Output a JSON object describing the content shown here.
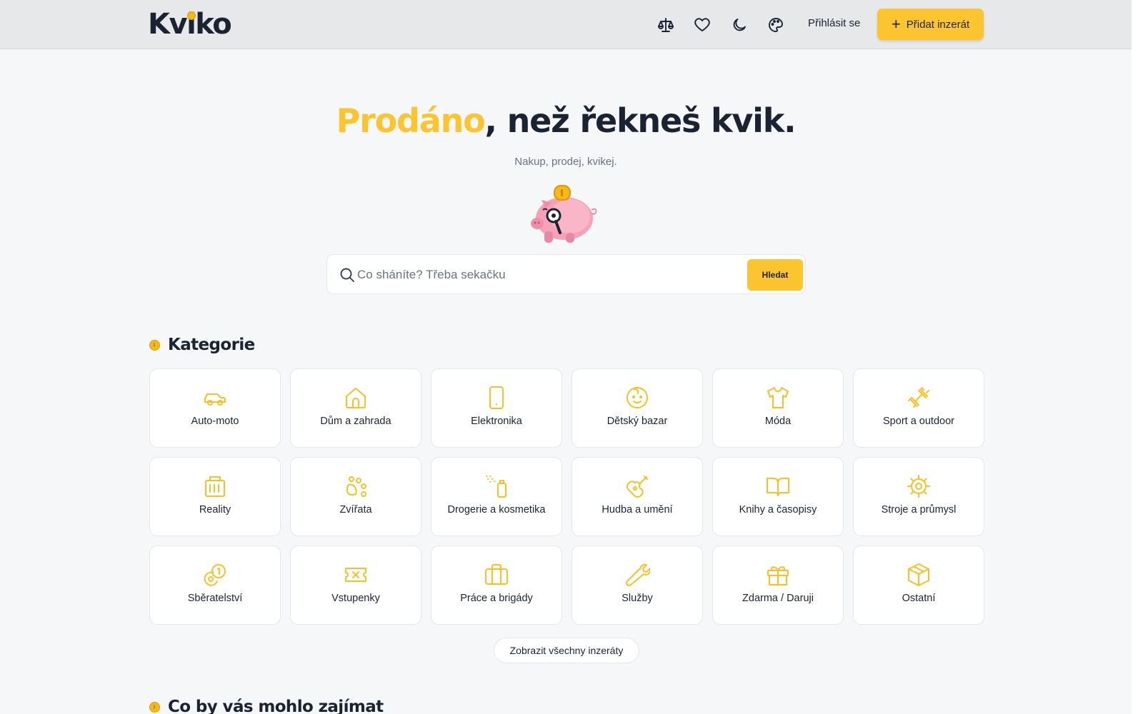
{
  "header": {
    "logo": "Kviko",
    "icons": [
      "scale-icon",
      "heart-icon",
      "moon-icon",
      "palette-icon"
    ],
    "login_label": "Přihlásit se",
    "add_label": "Přidat inzerát"
  },
  "hero": {
    "title_accent": "Prodáno",
    "title_rest": ", než řekneš kvik.",
    "subtitle": "Nakup, prodej, kvikej."
  },
  "search": {
    "placeholder": "Co sháníte? Třeba sekačku",
    "value": "",
    "button_label": "Hledat"
  },
  "categories_section": {
    "title": "Kategorie",
    "items": [
      {
        "label": "Auto-moto",
        "icon": "car-icon"
      },
      {
        "label": "Dům a zahrada",
        "icon": "house-icon"
      },
      {
        "label": "Elektronika",
        "icon": "phone-icon"
      },
      {
        "label": "Dětský bazar",
        "icon": "baby-icon"
      },
      {
        "label": "Móda",
        "icon": "tshirt-icon"
      },
      {
        "label": "Sport a outdoor",
        "icon": "dumbbell-icon"
      },
      {
        "label": "Reality",
        "icon": "building-icon"
      },
      {
        "label": "Zvířata",
        "icon": "paw-icon"
      },
      {
        "label": "Drogerie a kosmetika",
        "icon": "spray-icon"
      },
      {
        "label": "Hudba a umění",
        "icon": "guitar-icon"
      },
      {
        "label": "Knihy a časopisy",
        "icon": "book-icon"
      },
      {
        "label": "Stroje a průmysl",
        "icon": "gear-icon"
      },
      {
        "label": "Sběratelství",
        "icon": "coins-icon"
      },
      {
        "label": "Vstupenky",
        "icon": "ticket-icon"
      },
      {
        "label": "Práce a brigády",
        "icon": "briefcase-icon"
      },
      {
        "label": "Služby",
        "icon": "wrench-icon"
      },
      {
        "label": "Zdarma / Daruji",
        "icon": "gift-icon"
      },
      {
        "label": "Ostatní",
        "icon": "box-icon"
      }
    ],
    "show_all_label": "Zobrazit všechny inzeráty"
  },
  "interest_section": {
    "title": "Co by vás mohlo zajímat"
  },
  "colors": {
    "accent": "#fcc530",
    "text": "#1b2333",
    "background": "#f6f7f9",
    "header": "#e6e8ea"
  }
}
